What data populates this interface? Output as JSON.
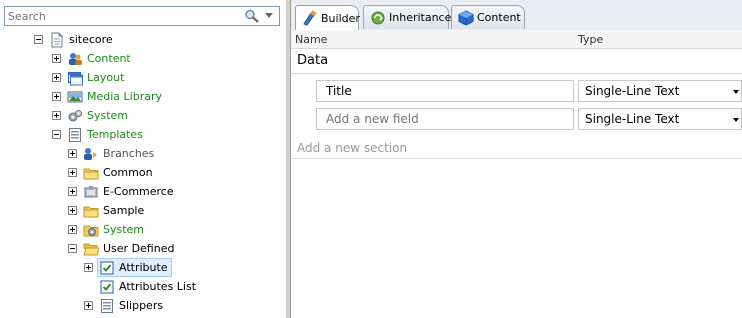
{
  "search": {
    "placeholder": "Search"
  },
  "tree": {
    "items": [
      {
        "label": "sitecore"
      },
      {
        "label": "Content"
      },
      {
        "label": "Layout"
      },
      {
        "label": "Media Library"
      },
      {
        "label": "System"
      },
      {
        "label": "Templates"
      },
      {
        "label": "Branches"
      },
      {
        "label": "Common"
      },
      {
        "label": "E-Commerce"
      },
      {
        "label": "Sample"
      },
      {
        "label": "System"
      },
      {
        "label": "User Defined"
      },
      {
        "label": "Attribute"
      },
      {
        "label": "Attributes List"
      },
      {
        "label": "Slippers"
      }
    ]
  },
  "tabs": [
    {
      "label": "Builder"
    },
    {
      "label": "Inheritance"
    },
    {
      "label": "Content"
    }
  ],
  "columns": {
    "name": "Name",
    "type": "Type"
  },
  "section": {
    "title": "Data",
    "fields": [
      {
        "name": "Title",
        "type": "Single-Line Text"
      }
    ],
    "new_field_placeholder": "Add a new field",
    "new_field_type": "Single-Line Text"
  },
  "new_section_placeholder": "Add a new section"
}
